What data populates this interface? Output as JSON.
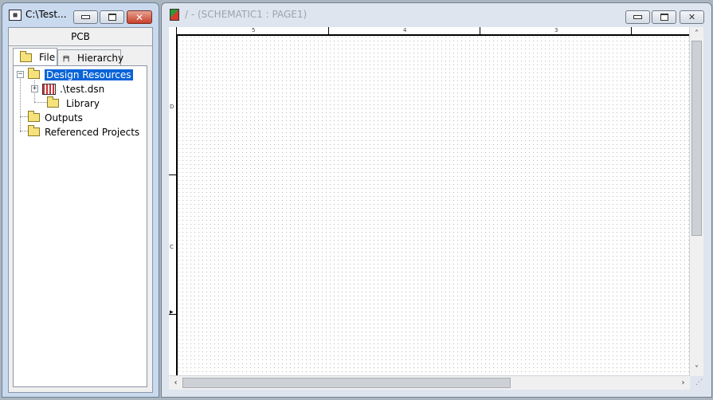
{
  "project_window": {
    "title": "C:\\Test...",
    "panel_header": "PCB",
    "tabs": [
      {
        "label": "File",
        "selected": true
      },
      {
        "label": "Hierarchy",
        "selected": false
      }
    ],
    "tree": [
      {
        "label": "Design Resources",
        "icon": "folder-icon",
        "selected": true
      },
      {
        "label": ".\\test.dsn",
        "icon": "schematic-file-icon"
      },
      {
        "label": "Library",
        "icon": "folder-icon"
      },
      {
        "label": "Outputs",
        "icon": "folder-icon"
      },
      {
        "label": "Referenced Projects",
        "icon": "folder-icon"
      }
    ]
  },
  "schematic_window": {
    "title": "/ - (SCHEMATIC1 : PAGE1)",
    "ruler_top": [
      "5",
      "4",
      "3"
    ],
    "ruler_left": [
      "D",
      "C"
    ]
  },
  "colors": {
    "selection": "#0a64d8",
    "close_button": "#c9402a",
    "desktop": "#abb5c0"
  }
}
